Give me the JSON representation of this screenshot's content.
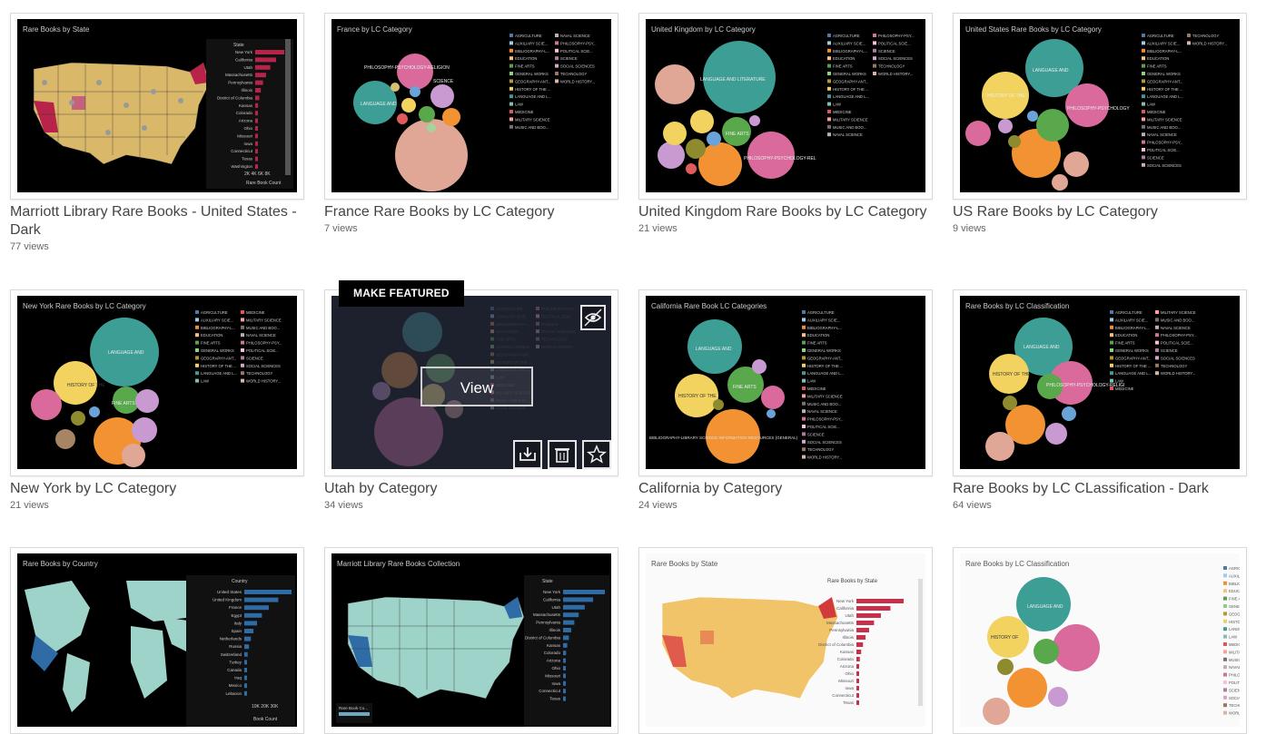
{
  "cards": [
    {
      "title": "Marriott Library Rare Books - United States - Dark",
      "views": "77 views",
      "thumb_title": "Rare Books by State"
    },
    {
      "title": "France Rare Books by LC Category",
      "views": "7 views",
      "thumb_title": "France by LC Category"
    },
    {
      "title": "United Kingdom Rare Books by LC Category",
      "views": "21 views",
      "thumb_title": "United Kingdom by LC Category"
    },
    {
      "title": "US Rare Books by LC Category",
      "views": "9 views",
      "thumb_title": "United States Rare Books by LC Category"
    },
    {
      "title": "New York by LC Category",
      "views": "21 views",
      "thumb_title": "New York Rare Books by LC Category"
    },
    {
      "title": "Utah by Category",
      "views": "34 views",
      "thumb_title": ""
    },
    {
      "title": "California by Category",
      "views": "24 views",
      "thumb_title": "California Rare Book LC Categories"
    },
    {
      "title": "Rare Books by LC CLassification - Dark",
      "views": "64 views",
      "thumb_title": "Rare Books by LC Classification"
    },
    {
      "title": "",
      "views": "",
      "thumb_title": "Rare Books by Country"
    },
    {
      "title": "",
      "views": "",
      "thumb_title": "Marriott Library Rare Books Collection"
    },
    {
      "title": "",
      "views": "",
      "thumb_title": "Rare Books by State"
    },
    {
      "title": "",
      "views": "",
      "thumb_title": "Rare Books by LC Classification"
    }
  ],
  "hover": {
    "make_featured": "MAKE FEATURED",
    "view": "View"
  },
  "icons": [
    "hide-eye-icon",
    "download-icon",
    "delete-icon",
    "star-icon"
  ],
  "thumb_text": {
    "legend_header": "State",
    "states": [
      "New York",
      "California",
      "Utah",
      "Massachusetts",
      "Pennsylvania",
      "Illinois",
      "District of Columbia",
      "Kansas",
      "Colorado",
      "Arizona",
      "Ohio",
      "Missouri",
      "Iowa",
      "Connecticut",
      "Texas",
      "Washington"
    ],
    "rare_book_count": "Rare Book Count",
    "axis_ticks": [
      "2K",
      "4K",
      "6K",
      "8K"
    ],
    "lc_header": "LC Category",
    "lc_items": [
      "AGRICULTURE",
      "AUXILIARY SCIE...",
      "BIBLIOGRAPHY-L...",
      "EDUCATION",
      "FINE ARTS",
      "GENERAL WORKS",
      "GEOGRAPHY-ANT...",
      "HISTORY OF THE ...",
      "LANGUAGE AND L...",
      "LAW",
      "MEDICINE",
      "MILITARY SCIENCE",
      "MUSIC AND BOO...",
      "NAVAL SCIENCE",
      "PHILOSOPHY-PSY...",
      "POLITICAL SCIE...",
      "SCIENCE",
      "SOCIAL SCIENCES",
      "TECHNOLOGY",
      "WORLD HISTORY..."
    ],
    "lc_classification_header": "LC Classification",
    "country_header": "Country",
    "countries": [
      "United States",
      "United Kingdom",
      "France",
      "Egypt",
      "Italy",
      "Spain",
      "Netherlands",
      "Russia",
      "Switzerland",
      "Turkey",
      "Canada",
      "Iraq",
      "Mexico",
      "Lebanon"
    ],
    "book_count": "Book Count",
    "country_ticks": [
      "10K",
      "20K",
      "30K"
    ],
    "map_legend_label": "Rare Book Co...",
    "map_legend_min": "3",
    "map_legend_max": "4,000",
    "ca_bottom_label": "BIBLIOGRAPHY-LIBRARY SCIENCE-INFORMATION RESOURCES (GENERAL)",
    "bubble_labels": {
      "language": "LANGUAGE AND LITERATURE",
      "philosophy": "PHILOSOPHY-PSYCHOLOGY-RELIGION",
      "science": "SCIENCE",
      "world_history": "WORLD HISTORY AND HISTORY OF EUROPE, ASIA, AFRICA, AUSTRALIA, NEW",
      "history_americas": "HISTORY OF THE AMERICAS",
      "fine_arts": "FINE ARTS",
      "social_sciences": "SOCIAL SCIENCES",
      "world_history_short": "WORLD HISTORY"
    }
  },
  "colors": {
    "teal": "#3d9e96",
    "yellow": "#f2d35f",
    "orange": "#f39232",
    "pink": "#d96a9b",
    "salmon": "#e09c8f",
    "green": "#59a84b",
    "lavender": "#c89ad1",
    "map_tan": "#d9b86a",
    "map_red": "#b8234a"
  }
}
